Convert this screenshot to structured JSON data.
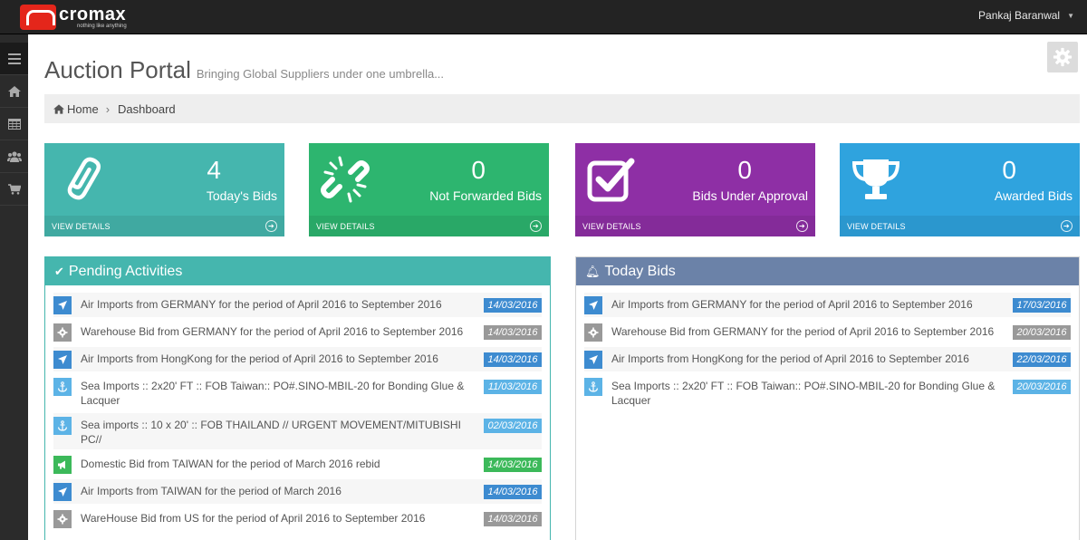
{
  "brand": {
    "name": "cromax",
    "tagline": "nothing like anything"
  },
  "user": {
    "name": "Pankaj Baranwal"
  },
  "header": {
    "title": "Auction Portal",
    "subtitle": "Bringing Global Suppliers under one umbrella..."
  },
  "breadcrumb": {
    "home": "Home",
    "current": "Dashboard"
  },
  "sidebar": {
    "items": [
      "menu-icon",
      "home-icon",
      "table-icon",
      "users-icon",
      "cart-icon"
    ]
  },
  "tiles": [
    {
      "count": "4",
      "label": "Today's Bids",
      "link": "VIEW DETAILS",
      "color": "#45b6ae",
      "icon": "paperclip-icon"
    },
    {
      "count": "0",
      "label": "Not Forwarded Bids",
      "link": "VIEW DETAILS",
      "color": "#2db56f",
      "icon": "broken-link-icon"
    },
    {
      "count": "0",
      "label": "Bids Under Approval",
      "link": "VIEW DETAILS",
      "color": "#8e2fa5",
      "icon": "checkbox-icon"
    },
    {
      "count": "0",
      "label": "Awarded Bids",
      "link": "VIEW DETAILS",
      "color": "#2fa3de",
      "icon": "trophy-icon"
    }
  ],
  "pending": {
    "title": "Pending Activities",
    "header_color": "#45b6ae",
    "items": [
      {
        "type": "air",
        "text": "Air Imports from GERMANY for the period of April 2016 to September 2016",
        "date": "14/03/2016",
        "date_color": "#3d8bd0"
      },
      {
        "type": "warehouse",
        "text": "Warehouse Bid from GERMANY for the period of April 2016 to September 2016",
        "date": "14/03/2016",
        "date_color": "#999999"
      },
      {
        "type": "air",
        "text": "Air Imports from HongKong for the period of April 2016 to September 2016",
        "date": "14/03/2016",
        "date_color": "#3d8bd0"
      },
      {
        "type": "sea",
        "text": "Sea Imports :: 2x20' FT :: FOB Taiwan:: PO#.SINO-MBIL-20 for Bonding Glue & Lacquer",
        "date": "11/03/2016",
        "date_color": "#5cb3e6"
      },
      {
        "type": "sea",
        "text": "Sea imports :: 10 x 20' :: FOB THAILAND // URGENT MOVEMENT/MITUBISHI PC//",
        "date": "02/03/2016",
        "date_color": "#5cb3e6"
      },
      {
        "type": "domestic",
        "text": "Domestic Bid from TAIWAN for the period of March 2016 rebid",
        "date": "14/03/2016",
        "date_color": "#3cb95a"
      },
      {
        "type": "air",
        "text": "Air Imports from TAIWAN for the period of March 2016",
        "date": "14/03/2016",
        "date_color": "#3d8bd0"
      },
      {
        "type": "warehouse",
        "text": "WareHouse Bid from US for the period of April 2016 to September 2016",
        "date": "14/03/2016",
        "date_color": "#999999"
      }
    ]
  },
  "today": {
    "title": "Today Bids",
    "header_color": "#6b82a8",
    "items": [
      {
        "type": "air",
        "text": "Air Imports from GERMANY for the period of April 2016 to September 2016",
        "date": "17/03/2016",
        "date_color": "#3d8bd0"
      },
      {
        "type": "warehouse",
        "text": "Warehouse Bid from GERMANY for the period of April 2016 to September 2016",
        "date": "20/03/2016",
        "date_color": "#999999"
      },
      {
        "type": "air",
        "text": "Air Imports from HongKong for the period of April 2016 to September 2016",
        "date": "22/03/2016",
        "date_color": "#3d8bd0"
      },
      {
        "type": "sea",
        "text": "Sea Imports :: 2x20' FT :: FOB Taiwan:: PO#.SINO-MBIL-20 for Bonding Glue & Lacquer",
        "date": "20/03/2016",
        "date_color": "#5cb3e6"
      }
    ]
  },
  "icon_colors": {
    "air": "#3d8bd0",
    "warehouse": "#999999",
    "sea": "#5cb3e6",
    "domestic": "#3cb95a"
  }
}
